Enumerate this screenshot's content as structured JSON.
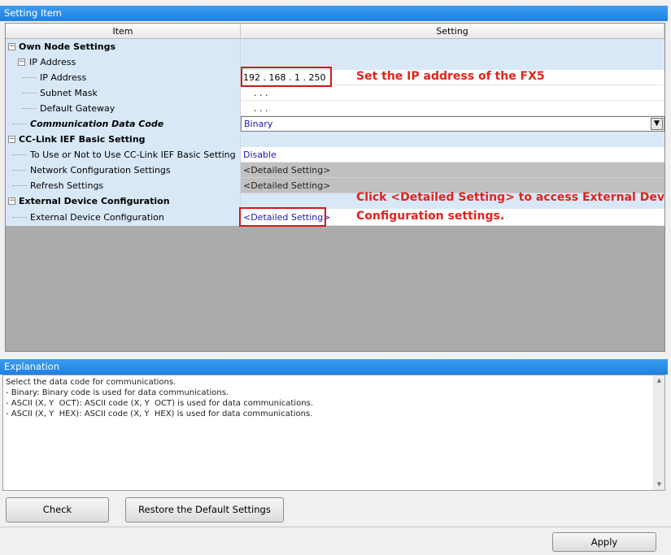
{
  "setting_item": {
    "header": "Setting Item",
    "col_item": "Item",
    "col_setting": "Setting",
    "rows": [
      {
        "label": "Own Node Settings",
        "setting": ""
      },
      {
        "label": "IP Address",
        "setting": ""
      },
      {
        "label": "IP Address",
        "setting": "192 . 168 .   1 . 250"
      },
      {
        "label": "Subnet Mask",
        "setting": "  .    .    ."
      },
      {
        "label": "Default Gateway",
        "setting": "  .    .    ."
      },
      {
        "label": "Communication Data Code",
        "setting": "Binary"
      },
      {
        "label": "CC-Link IEF Basic Setting",
        "setting": ""
      },
      {
        "label": "To Use or Not to Use CC-Link IEF Basic Setting",
        "setting": "Disable"
      },
      {
        "label": "Network Configuration Settings",
        "setting": "<Detailed Setting>"
      },
      {
        "label": "Refresh Settings",
        "setting": "<Detailed Setting>"
      },
      {
        "label": "External Device Configuration",
        "setting": ""
      },
      {
        "label": "External Device Configuration",
        "setting": "<Detailed Setting>"
      }
    ]
  },
  "annotations": {
    "ip": "Set the IP address of the FX5",
    "detail_line1": "Click <Detailed Setting> to access External Device",
    "detail_line2": "Configuration settings."
  },
  "explanation": {
    "header": "Explanation",
    "text": "Select the data code for communications.\n- Binary: Binary code is used for data communications.\n- ASCII (X, Y  OCT): ASCII code (X, Y  OCT) is used for data communications.\n- ASCII (X, Y  HEX): ASCII code (X, Y  HEX) is used for data communications."
  },
  "buttons": {
    "check": "Check",
    "restore": "Restore the Default Settings",
    "apply": "Apply"
  },
  "colors": {
    "header_blue": "#1f7fe0",
    "tree_blue": "#d9e8f7",
    "annotation_red": "#e0231c",
    "link_blue": "#1a1aa8"
  }
}
